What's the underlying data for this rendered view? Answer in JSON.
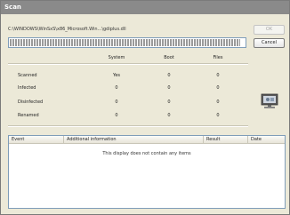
{
  "window": {
    "title": "Scan"
  },
  "scan": {
    "path": "C:\\WINDOWS\\WinSxS\\x86_Microsoft.Win...\\gdiplus.dll",
    "progress": 0.98
  },
  "buttons": {
    "ok_label": "OK",
    "cancel_label": "Cancel"
  },
  "stats": {
    "columns": [
      "System",
      "Boot",
      "Files"
    ],
    "rows": [
      {
        "label": "Scanned",
        "values": [
          "Yes",
          "0",
          "0"
        ]
      },
      {
        "label": "Infected",
        "values": [
          "0",
          "0",
          "0"
        ]
      },
      {
        "label": "Disinfected",
        "values": [
          "0",
          "0",
          "0"
        ]
      },
      {
        "label": "Renamed",
        "values": [
          "0",
          "0",
          "0"
        ]
      }
    ]
  },
  "events": {
    "columns": [
      "Event",
      "Additional information",
      "Result",
      "Date"
    ],
    "empty_message": "This display does not contain any items"
  },
  "icons": {
    "monitor": "computer-monitor-icon"
  }
}
